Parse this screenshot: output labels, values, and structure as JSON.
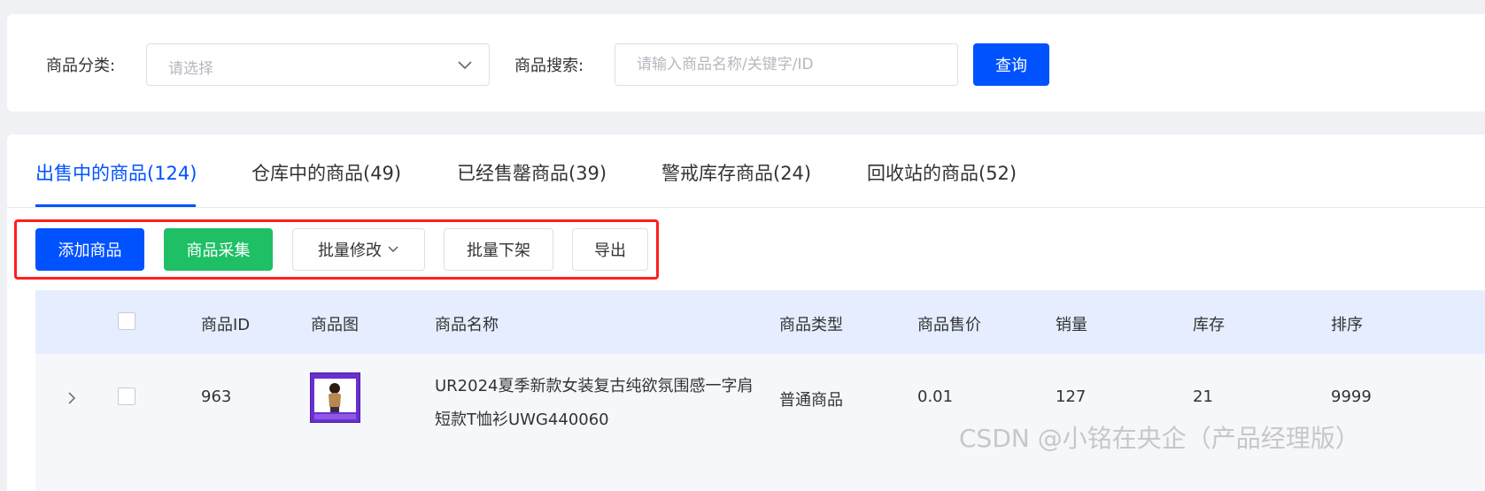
{
  "filters": {
    "category_label": "商品分类:",
    "category_placeholder": "请选择",
    "search_label": "商品搜索:",
    "search_placeholder": "请输入商品名称/关键字/ID",
    "query_button": "查询"
  },
  "tabs": [
    {
      "label": "出售中的商品(124)",
      "active": true
    },
    {
      "label": "仓库中的商品(49)"
    },
    {
      "label": "已经售罄商品(39)"
    },
    {
      "label": "警戒库存商品(24)"
    },
    {
      "label": "回收站的商品(52)"
    }
  ],
  "actions": {
    "add": "添加商品",
    "collect": "商品采集",
    "batch_edit": "批量修改",
    "batch_off": "批量下架",
    "export": "导出"
  },
  "table": {
    "headers": [
      "商品ID",
      "商品图",
      "商品名称",
      "商品类型",
      "商品售价",
      "销量",
      "库存",
      "排序"
    ],
    "rows": [
      {
        "id": "963",
        "name": "UR2024夏季新款女装复古纯欲氛围感一字肩短款T恤衫UWG440060",
        "type": "普通商品",
        "price": "0.01",
        "sales": "127",
        "stock": "21",
        "sort": "9999"
      }
    ]
  },
  "watermark": "CSDN @小铭在央企（产品经理版）",
  "colors": {
    "primary": "#0052ff",
    "green": "#1fbf65",
    "highlight_frame": "#ff1f1f",
    "table_header_bg": "#e5edff"
  },
  "icons": {
    "select_arrow": "chevron-down-icon",
    "batch_edit_arrow": "chevron-down-icon",
    "row_expand": "chevron-right-icon"
  }
}
